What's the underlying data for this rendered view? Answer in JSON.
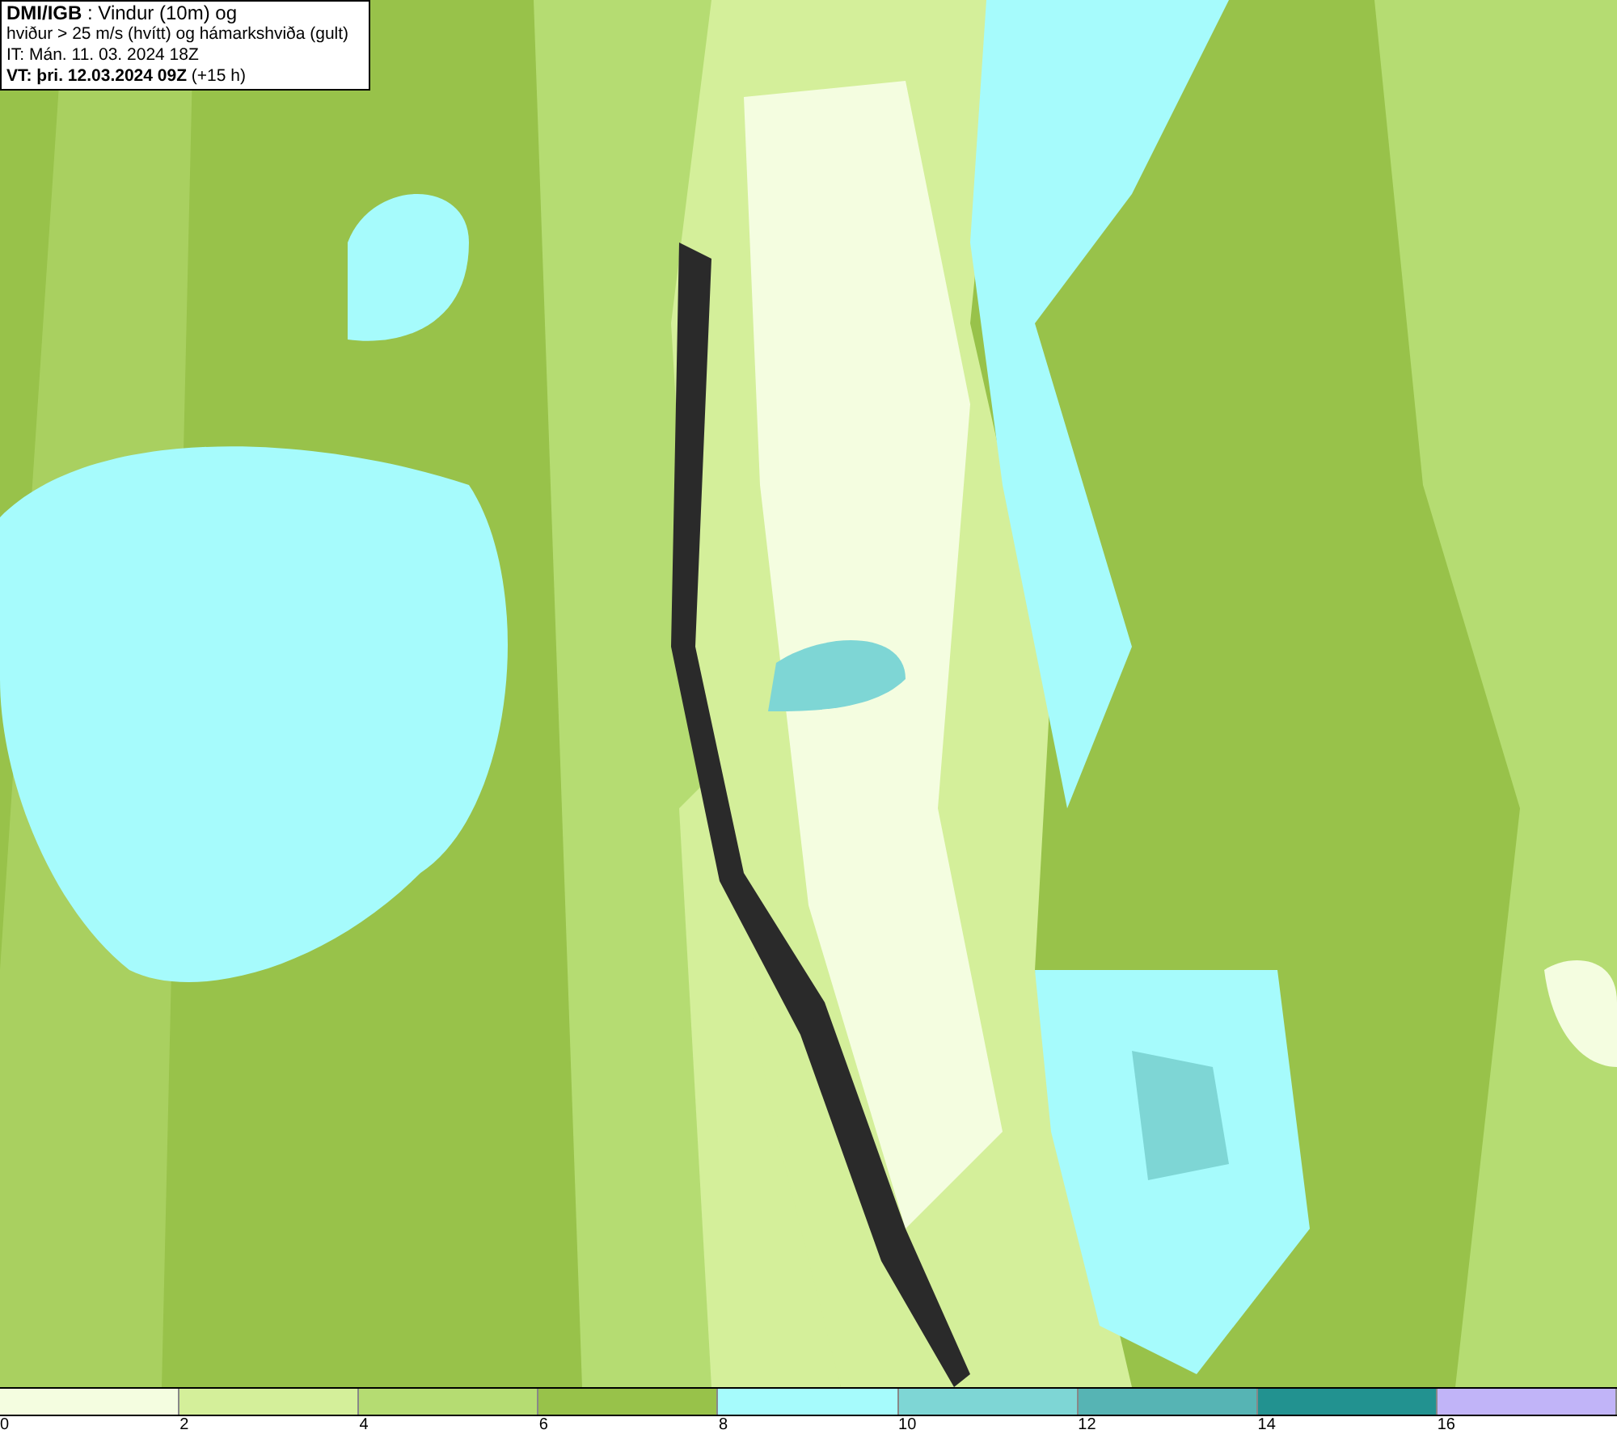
{
  "header": {
    "lines": [
      "**DMI/IGB** : Vindur (10m) og",
      "hviður > 25 m/s (hvítt) og hámarkshviða (gult)",
      "IT: Mán. 11. 03. 2024 18Z",
      "**VT: þri. 12.03.2024 09Z** (+15 h)"
    ]
  },
  "legend": [
    {
      "label": "0",
      "color": "#f4fde0"
    },
    {
      "label": "2",
      "color": "#d4ef9a"
    },
    {
      "label": "4",
      "color": "#b5dc72"
    },
    {
      "label": "6",
      "color": "#98c24a"
    },
    {
      "label": "8",
      "color": "#a6fbfc"
    },
    {
      "label": "10",
      "color": "#7ed6d5"
    },
    {
      "label": "12",
      "color": "#56b4b4"
    },
    {
      "label": "14",
      "color": "#229290"
    },
    {
      "label": "16",
      "color": "#c1b4f8"
    }
  ]
}
